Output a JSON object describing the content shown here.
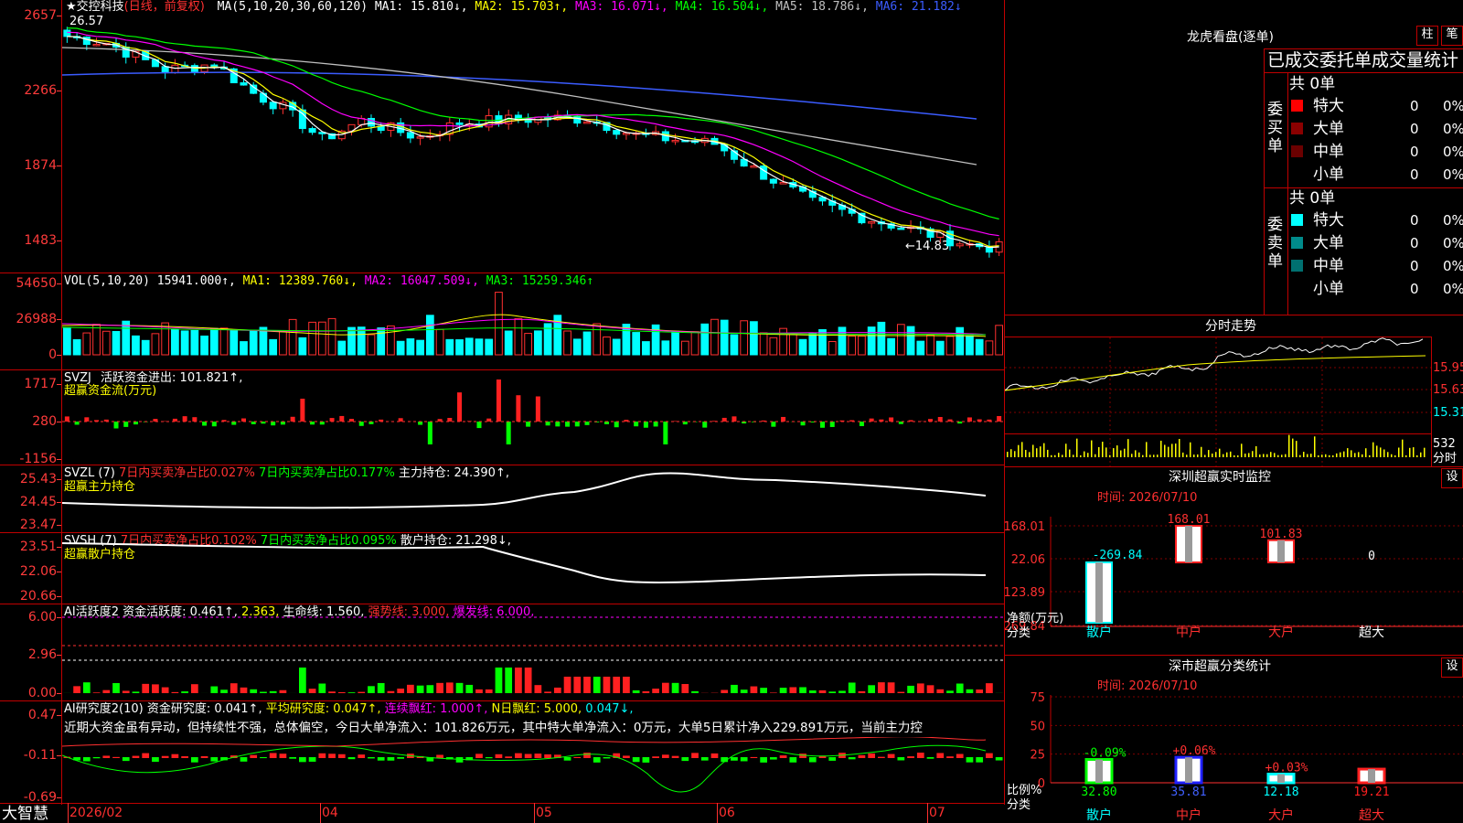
{
  "stock": {
    "name": "交控科技",
    "mode": "(日线，前复权)",
    "star": "★"
  },
  "ma_header": {
    "label": "MA(5,10,20,30,60,120)",
    "items": [
      {
        "t": "MA1: 15.810↓,",
        "c": "#ffffff"
      },
      {
        "t": "MA2: 15.703↑,",
        "c": "#ffff00"
      },
      {
        "t": "MA3: 16.071↓,",
        "c": "#ff00ff"
      },
      {
        "t": "MA4: 16.504↓,",
        "c": "#00ff00"
      },
      {
        "t": "MA5: 18.786↓,",
        "c": "#c0c0c0"
      },
      {
        "t": "MA6: 21.182↓",
        "c": "#3b5cff"
      }
    ]
  },
  "price_axis": [
    "2657",
    "2266",
    "1874",
    "1483"
  ],
  "price_marks": {
    "high": "26.57",
    "low": "←14.83"
  },
  "vol_header": {
    "label": "VOL(5,10,20)",
    "value": "15941.000↑,",
    "items": [
      {
        "t": "MA1: 12389.760↓,",
        "c": "#ffff00"
      },
      {
        "t": "MA2: 16047.509↓,",
        "c": "#ff00ff"
      },
      {
        "t": "MA3: 15259.346↑",
        "c": "#00ff00"
      }
    ]
  },
  "vol_axis": [
    "54650",
    "26988",
    "0"
  ],
  "svzj": {
    "name": "SVZJ",
    "text": "活跃资金进出: 101.821↑,",
    "subtitle": "超赢资金流(万元)",
    "axis": [
      "1717",
      "280",
      "-1156"
    ]
  },
  "svzl": {
    "name": "SVZL (7)",
    "a": "7日内买卖净占比0.027%",
    "b": "7日内买卖净占比0.177%",
    "c": "主力持仓: 24.390↑,",
    "subtitle": "超赢主力持仓",
    "axis": [
      "25.43",
      "24.45",
      "23.47"
    ]
  },
  "svsh": {
    "name": "SVSH (7)",
    "a": "7日内买卖净占比0.102%",
    "b": "7日内买卖净占比0.095%",
    "c": "散户持仓: 21.298↓,",
    "subtitle": "超赢散户持仓",
    "axis": [
      "23.51",
      "22.06",
      "20.66"
    ]
  },
  "ai1": {
    "name": "AI活跃度2",
    "a": "资金活跃度: 0.461↑,",
    "b": "2.363,",
    "c": "生命线: 1.560,",
    "d": "强势线: 3.000,",
    "e": "爆发线: 6.000,",
    "axis": [
      "6.00",
      "2.96",
      "0.00"
    ]
  },
  "ai2": {
    "name": "AI研究度2(10)",
    "a": "资金研究度: 0.041↑,",
    "b": "平均研究度: 0.047↑,",
    "c": "连续飘红: 1.000↑,",
    "d": "N日飘红: 5.000,",
    "e": "0.047↓,",
    "note": "近期大资金虽有异动，但持续性不强，总体偏空，今日大单净流入：101.826万元，其中特大单净流入：0万元，大单5日累计净入229.891万元，当前主力控",
    "axis": [
      "0.47",
      "-0.11",
      "-0.69"
    ]
  },
  "footer": {
    "brand": "大智慧",
    "dates": [
      "2026/02",
      "04",
      "05",
      "06",
      "07"
    ]
  },
  "dragon": {
    "title": "龙虎看盘(逐单)",
    "btn1": "柱",
    "btn2": "笔",
    "subtitle": "已成交委托单成交量统计",
    "buy": {
      "side": "委买单",
      "total": "共 0单",
      "rows": [
        {
          "n": "特大",
          "v": "0",
          "p": "0%",
          "c": "#ff0000"
        },
        {
          "n": "大单",
          "v": "0",
          "p": "0%",
          "c": "#8b0000"
        },
        {
          "n": "中单",
          "v": "0",
          "p": "0%",
          "c": "#6b0000"
        },
        {
          "n": "小单",
          "v": "0",
          "p": "0%",
          "c": "#000000"
        }
      ]
    },
    "sell": {
      "side": "委卖单",
      "total": "共 0单",
      "rows": [
        {
          "n": "特大",
          "v": "0",
          "p": "0%",
          "c": "#00ffff"
        },
        {
          "n": "大单",
          "v": "0",
          "p": "0%",
          "c": "#008b8b"
        },
        {
          "n": "中单",
          "v": "0",
          "p": "0%",
          "c": "#007070"
        },
        {
          "n": "小单",
          "v": "0",
          "p": "0%",
          "c": "#000000"
        }
      ]
    }
  },
  "intraday": {
    "title": "分时走势",
    "axis": [
      "15.95",
      "15.63",
      "15.31"
    ],
    "vol_axis": [
      "532"
    ],
    "vol_label": "分时"
  },
  "monitor": {
    "title": "深圳超赢实时监控",
    "btn": "设",
    "time": "时间: 2026/07/10",
    "axis": [
      "168.01",
      "22.06",
      "-123.89",
      "-269.84"
    ],
    "ylabel": "净额(万元)",
    "xlabel": "分类",
    "categories": [
      "散户",
      "中户",
      "大户",
      "超大"
    ],
    "values": [
      -269.84,
      168.01,
      101.83,
      0
    ],
    "labels": [
      "-269.84",
      "168.01",
      "101.83",
      "0"
    ]
  },
  "classify": {
    "title": "深市超赢分类统计",
    "btn": "设",
    "time": "时间: 2026/07/10",
    "axis": [
      "75",
      "50",
      "25",
      "0"
    ],
    "ylabel": "比例%",
    "xlabel": "分类",
    "categories": [
      "散户",
      "中户",
      "大户",
      "超大"
    ],
    "values": [
      32.8,
      35.81,
      12.18,
      19.21
    ],
    "labels": [
      "32.80",
      "35.81",
      "12.18",
      "19.21"
    ],
    "changes": [
      "-0.09%",
      "+0.06%",
      "+0.03%",
      ""
    ],
    "colors": [
      "#00ff00",
      "#2020ff",
      "#00ffff",
      "#ff2020"
    ]
  }
}
